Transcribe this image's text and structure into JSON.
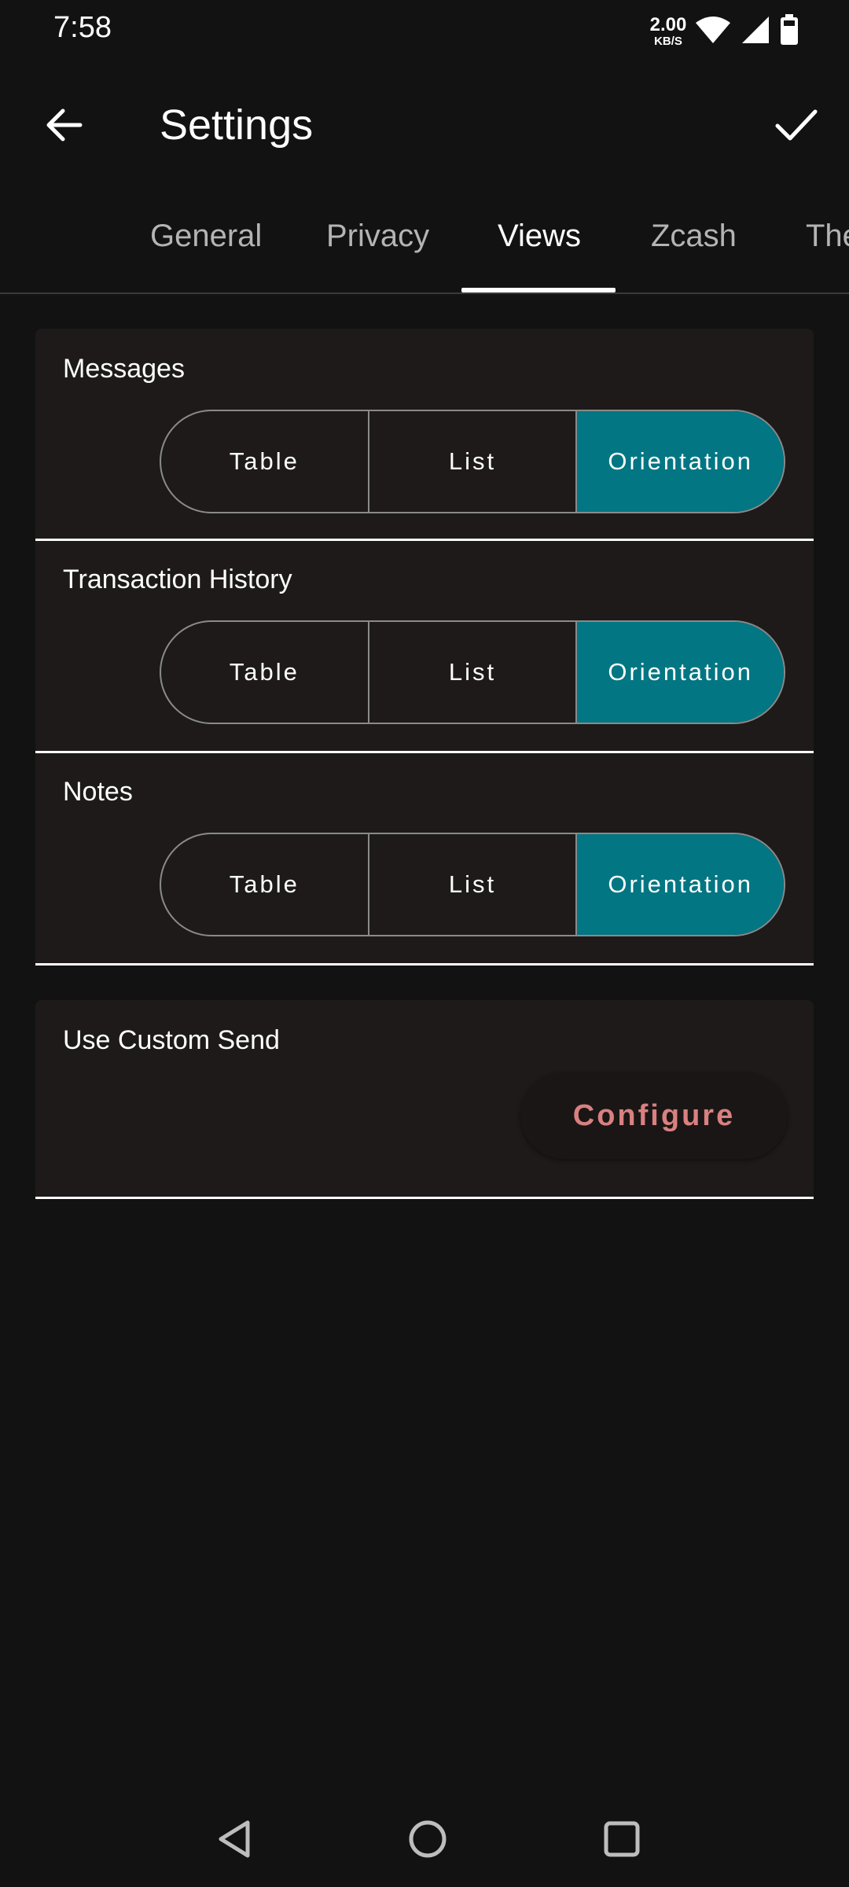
{
  "status_bar": {
    "time": "7:58",
    "net_speed_value": "2.00",
    "net_speed_unit": "KB/S",
    "icons": [
      "wifi-icon",
      "cellular-signal-icon",
      "battery-icon"
    ]
  },
  "app_bar": {
    "title": "Settings",
    "back_icon": "arrow-back-icon",
    "confirm_icon": "check-icon"
  },
  "tabs": [
    {
      "label": "General",
      "active": false
    },
    {
      "label": "Privacy",
      "active": false
    },
    {
      "label": "Views",
      "active": true
    },
    {
      "label": "Zcash",
      "active": false
    },
    {
      "label": "The",
      "active": false
    }
  ],
  "view_settings": [
    {
      "title": "Messages",
      "options": [
        "Table",
        "List",
        "Orientation"
      ],
      "selected": "Orientation"
    },
    {
      "title": "Transaction History",
      "options": [
        "Table",
        "List",
        "Orientation"
      ],
      "selected": "Orientation"
    },
    {
      "title": "Notes",
      "options": [
        "Table",
        "List",
        "Orientation"
      ],
      "selected": "Orientation"
    }
  ],
  "custom_send": {
    "title": "Use Custom Send",
    "button_label": "Configure"
  },
  "nav_bar": {
    "icons": [
      "back-triangle-icon",
      "home-circle-icon",
      "recents-square-icon"
    ]
  },
  "colors": {
    "background": "#121212",
    "card": "#1e1a1a",
    "selected_segment": "#037683",
    "configure_text": "#d98080"
  }
}
